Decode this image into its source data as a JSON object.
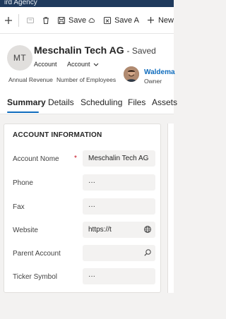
{
  "app": {
    "title": "ird Agency"
  },
  "command_bar": {
    "save_label": "Save",
    "save_and_close_label": "Save A",
    "new_label": "New"
  },
  "header": {
    "initials": "MT",
    "record_name": "Meschalin Tech AG",
    "save_status": "- Saved",
    "entity_type": "Account",
    "form_selector": "Account",
    "fields": [
      {
        "label": "Annual Revenue"
      },
      {
        "label": "Number of Employees"
      }
    ],
    "owner": {
      "name": "Waldema",
      "label": "Owner"
    }
  },
  "tabs": [
    {
      "label": "Summary",
      "active": true
    },
    {
      "label": "Details",
      "active": false
    },
    {
      "label": "Scheduling",
      "active": false
    },
    {
      "label": "Files",
      "active": false
    },
    {
      "label": "Assets",
      "active": false
    }
  ],
  "section": {
    "title": "ACCOUNT INFORMATION",
    "fields": [
      {
        "label": "Account Nome",
        "value": "Meschalin Tech AG",
        "required": "*"
      },
      {
        "label": "Phone",
        "value": "···"
      },
      {
        "label": "Fax",
        "value": "···"
      },
      {
        "label": "Website",
        "value": "https://t",
        "icon": "globe-icon"
      },
      {
        "label": "Parent Account",
        "value": "",
        "icon": "search-icon"
      },
      {
        "label": "Ticker Symbol",
        "value": "···"
      }
    ]
  },
  "colors": {
    "accent": "#0f6cbd",
    "required": "#c50f1f",
    "appbar": "#1f3a5c"
  }
}
